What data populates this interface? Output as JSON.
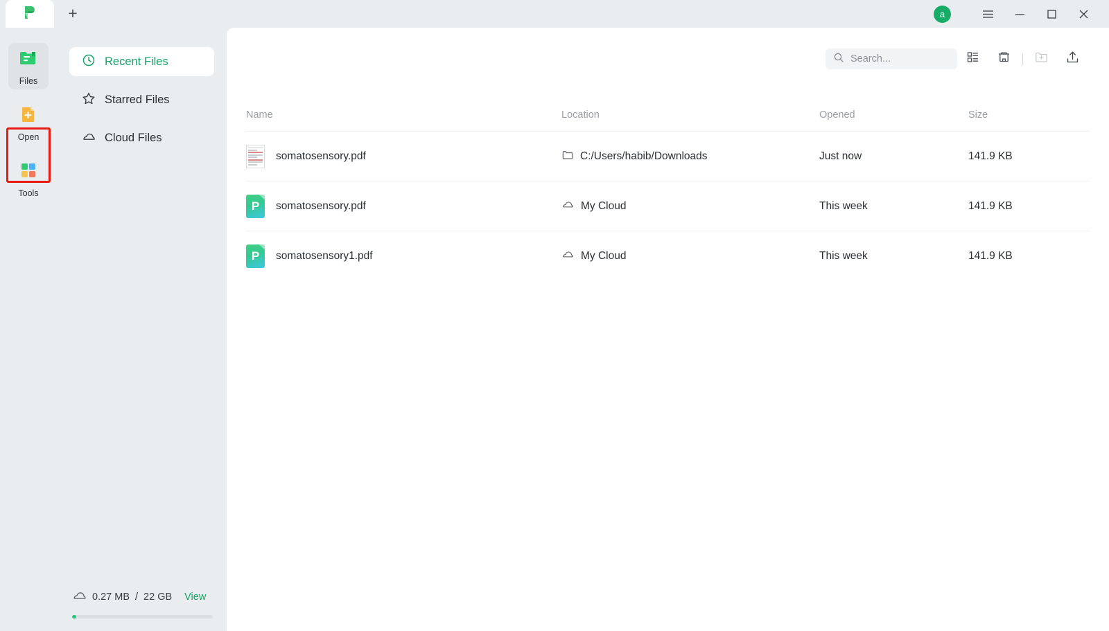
{
  "titlebar": {
    "tab_logo": "pdfelement-logo-icon",
    "new_tab_label": "+",
    "avatar_initial": "a",
    "menu_icon": "hamburger-menu-icon",
    "minimize_icon": "minimize-icon",
    "maximize_icon": "maximize-icon",
    "close_icon": "close-icon"
  },
  "rail": {
    "items": [
      {
        "label": "Files",
        "icon": "files-folder-icon",
        "active": true
      },
      {
        "label": "Open",
        "icon": "open-document-plus-icon",
        "active": false,
        "highlighted": true
      },
      {
        "label": "Tools",
        "icon": "tools-grid-icon",
        "active": false
      }
    ]
  },
  "nav": {
    "items": [
      {
        "label": "Recent Files",
        "icon": "clock-icon",
        "active": true
      },
      {
        "label": "Starred Files",
        "icon": "star-icon",
        "active": false
      },
      {
        "label": "Cloud Files",
        "icon": "cloud-icon",
        "active": false
      }
    ],
    "storage": {
      "icon": "cloud-icon",
      "used": "0.27 MB",
      "separator": "/",
      "total": "22 GB",
      "view_label": "View",
      "percent": 3
    }
  },
  "toolbar": {
    "search_placeholder": "Search...",
    "search_value": "",
    "search_icon": "search-icon",
    "list_view_icon": "list-view-icon",
    "trash_icon": "trash-icon",
    "new_folder_icon": "new-folder-icon",
    "upload_icon": "upload-icon"
  },
  "table": {
    "columns": [
      "Name",
      "Location",
      "Opened",
      "Size"
    ],
    "rows": [
      {
        "name": "somatosensory.pdf",
        "icon": "document-thumbnail-icon",
        "location": "C:/Users/habib/Downloads",
        "location_icon": "folder-icon",
        "opened": "Just now",
        "size": "141.9 KB"
      },
      {
        "name": "somatosensory.pdf",
        "icon": "pdf-cloud-file-icon",
        "location": "My Cloud",
        "location_icon": "cloud-icon",
        "opened": "This week",
        "size": "141.9 KB"
      },
      {
        "name": "somatosensory1.pdf",
        "icon": "pdf-cloud-file-icon",
        "location": "My Cloud",
        "location_icon": "cloud-icon",
        "opened": "This week",
        "size": "141.9 KB"
      }
    ]
  },
  "colors": {
    "accent_green": "#16a46a",
    "highlight_red": "#e81a12",
    "avatar_green": "#17ad68",
    "window_bg": "#eaedef"
  }
}
